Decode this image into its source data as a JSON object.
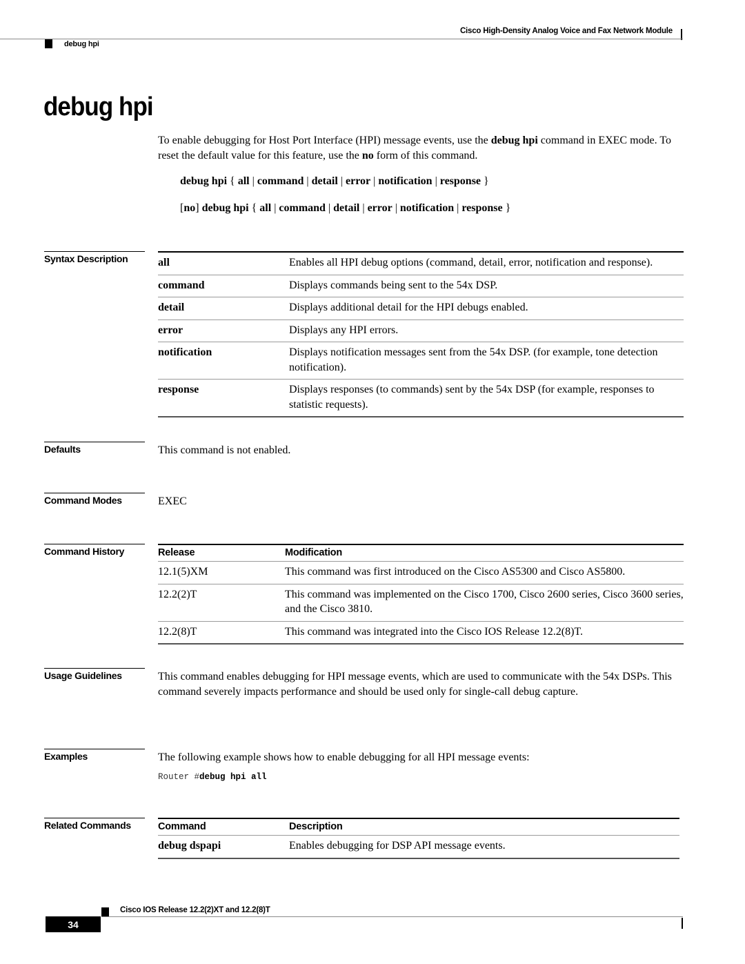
{
  "header": {
    "book_title": "Cisco High-Density Analog Voice and Fax Network Module",
    "section": "debug hpi"
  },
  "title": "debug hpi",
  "intro": {
    "p1_a": "To enable debugging for Host Port Interface (HPI) message events, use the ",
    "p1_b": "debug hpi",
    "p1_c": " command in EXEC mode. To reset the default value for this feature, use the ",
    "p1_d": "no",
    "p1_e": " form of this command."
  },
  "syntax": {
    "line1": {
      "prefix": "",
      "cmd": "debug hpi",
      "open": " { ",
      "options": [
        "all",
        "command",
        "detail",
        " error",
        "notification",
        "response"
      ],
      "close": " }"
    },
    "line2": {
      "prefix_open": "[",
      "prefix_kw": "no",
      "prefix_close": "] ",
      "cmd": "debug hpi",
      "open": " { ",
      "options": [
        "all",
        "command",
        "detail",
        " error",
        "notification",
        "response"
      ],
      "close": " }"
    },
    "separator": " | "
  },
  "sections": {
    "syntax_description": {
      "label": "Syntax Description",
      "rows": [
        {
          "keyword": "all",
          "description": "Enables all HPI debug options (command, detail, error, notification and response)."
        },
        {
          "keyword": "command",
          "description": "Displays commands being sent to the 54x DSP."
        },
        {
          "keyword": "detail",
          "description": "Displays additional detail for the HPI debugs enabled."
        },
        {
          "keyword": "error",
          "description": "Displays any HPI errors."
        },
        {
          "keyword": "notification",
          "description": "Displays notification messages sent from the 54x DSP. (for example, tone detection notification)."
        },
        {
          "keyword": "response",
          "description": "Displays responses (to commands) sent by the 54x DSP (for example, responses to statistic requests)."
        }
      ]
    },
    "defaults": {
      "label": "Defaults",
      "text": "This command is not enabled."
    },
    "command_modes": {
      "label": "Command Modes",
      "text": "EXEC"
    },
    "command_history": {
      "label": "Command History",
      "headers": [
        "Release",
        "Modification"
      ],
      "rows": [
        {
          "release": "12.1(5)XM",
          "modification": "This command was first introduced on the Cisco AS5300 and Cisco AS5800."
        },
        {
          "release": "12.2(2)T",
          "modification": "This command was implemented on the Cisco 1700, Cisco 2600 series, Cisco 3600 series, and the Cisco 3810."
        },
        {
          "release": "12.2(8)T",
          "modification": "This command was integrated into the Cisco IOS Release 12.2(8)T."
        }
      ]
    },
    "usage_guidelines": {
      "label": "Usage Guidelines",
      "text": "This command enables debugging for HPI message events, which are used to communicate with the 54x DSPs. This command severely impacts performance and should be used only for single-call debug capture."
    },
    "examples": {
      "label": "Examples",
      "text": "The following example shows how to enable debugging for all HPI message events:",
      "code_prompt": "Router #",
      "code_command": "debug hpi all"
    },
    "related_commands": {
      "label": "Related Commands",
      "headers": [
        "Command",
        "Description"
      ],
      "rows": [
        {
          "command": "debug dspapi",
          "description": "Enables debugging for DSP API message events."
        }
      ]
    }
  },
  "footer": {
    "release": "Cisco IOS Release 12.2(2)XT and 12.2(8)T",
    "page_number": "34"
  }
}
